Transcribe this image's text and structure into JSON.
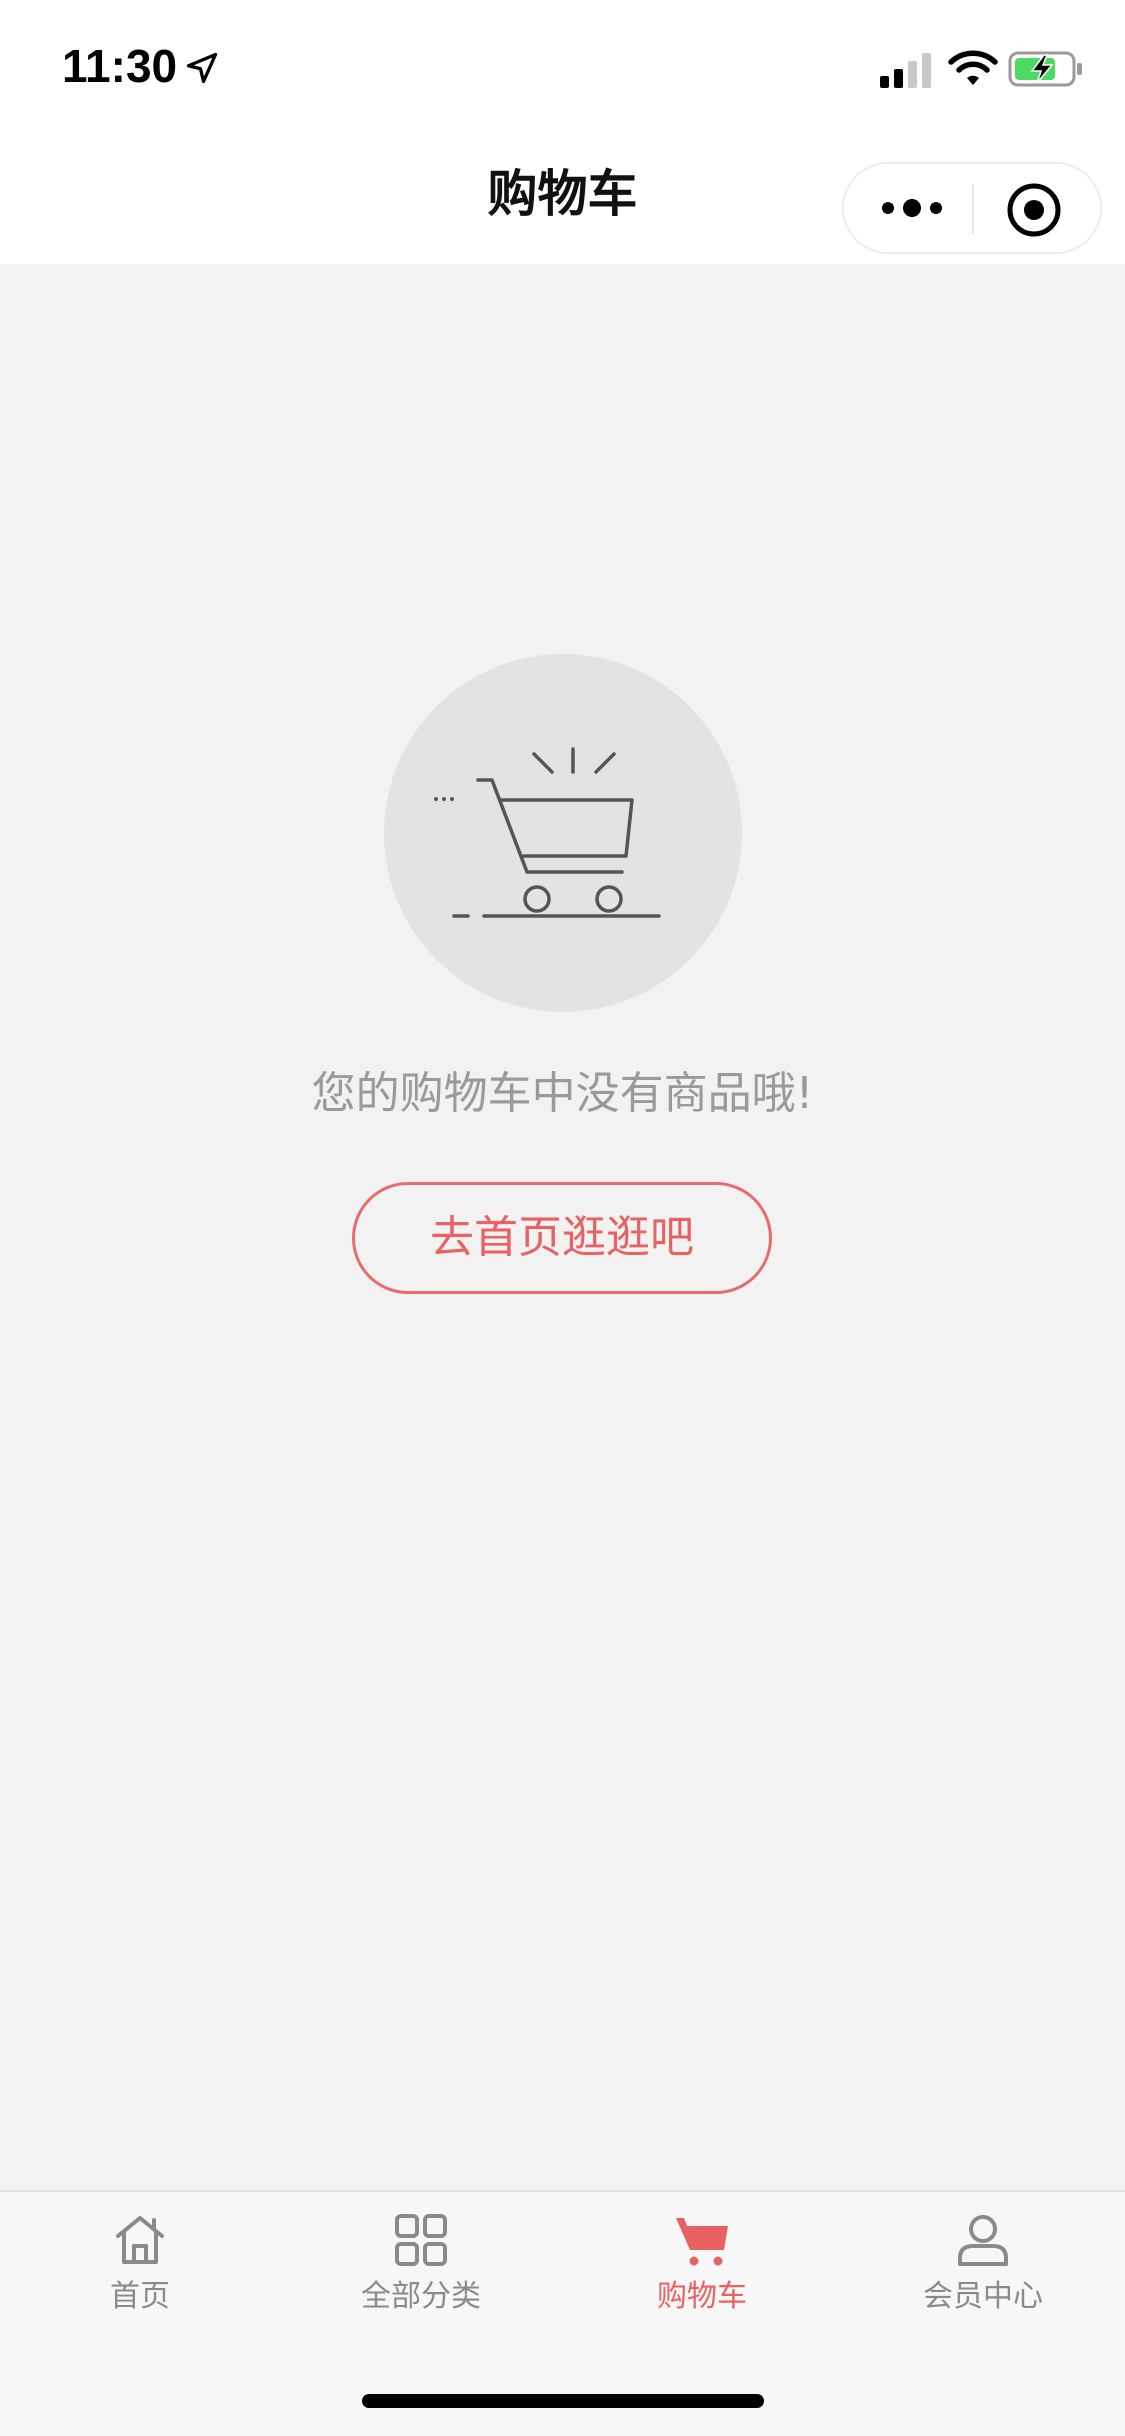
{
  "status_bar": {
    "time": "11:30",
    "icons": [
      "location-arrow-icon",
      "signal-icon",
      "wifi-icon",
      "battery-charging-icon"
    ]
  },
  "nav": {
    "title": "购物车",
    "capsule": {
      "more_icon": "more-dots-icon",
      "close_icon": "target-circle-icon"
    }
  },
  "empty_state": {
    "illustration": "empty-cart-icon",
    "message": "您的购物车中没有商品哦!",
    "button_label": "去首页逛逛吧"
  },
  "tab_bar": {
    "items": [
      {
        "label": "首页",
        "icon": "home-icon",
        "active": false
      },
      {
        "label": "全部分类",
        "icon": "grid-icon",
        "active": false
      },
      {
        "label": "购物车",
        "icon": "cart-icon",
        "active": true
      },
      {
        "label": "会员中心",
        "icon": "user-icon",
        "active": false
      }
    ]
  },
  "colors": {
    "accent": "#e96262",
    "background": "#f2f2f2",
    "circle": "#e3e3e3",
    "muted_text": "#9a9a9a"
  }
}
